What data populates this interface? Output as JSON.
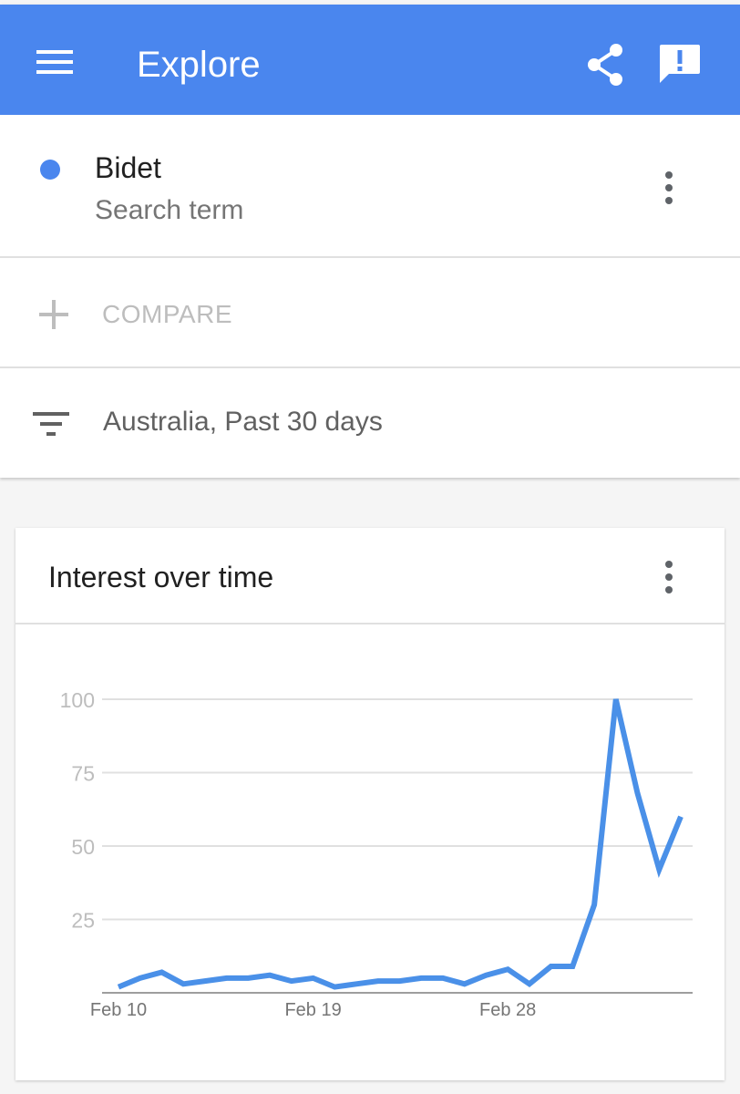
{
  "appbar": {
    "title": "Explore",
    "color": "#4a86ee",
    "icons": [
      "menu-icon",
      "share-icon",
      "feedback-icon"
    ]
  },
  "search_term": {
    "name": "Bidet",
    "type": "Search term",
    "color": "#4a86ee"
  },
  "compare": {
    "label": "COMPARE"
  },
  "filter": {
    "label": "Australia, Past 30 days"
  },
  "card": {
    "title": "Interest over time"
  },
  "chart_data": {
    "type": "line",
    "title": "Interest over time",
    "xlabel": "",
    "ylabel": "",
    "ylim": [
      0,
      100
    ],
    "yticks": [
      25,
      50,
      75,
      100
    ],
    "xtick_labels": [
      {
        "label": "Feb 10",
        "index": 0
      },
      {
        "label": "Feb 19",
        "index": 9
      },
      {
        "label": "Feb 28",
        "index": 18
      }
    ],
    "grid": true,
    "series": [
      {
        "color": "#4a90e8",
        "values": [
          2,
          5,
          7,
          3,
          4,
          5,
          5,
          6,
          4,
          5,
          2,
          3,
          4,
          4,
          5,
          5,
          3,
          6,
          8,
          3,
          9,
          9,
          30,
          100,
          68,
          42,
          60
        ]
      }
    ]
  }
}
